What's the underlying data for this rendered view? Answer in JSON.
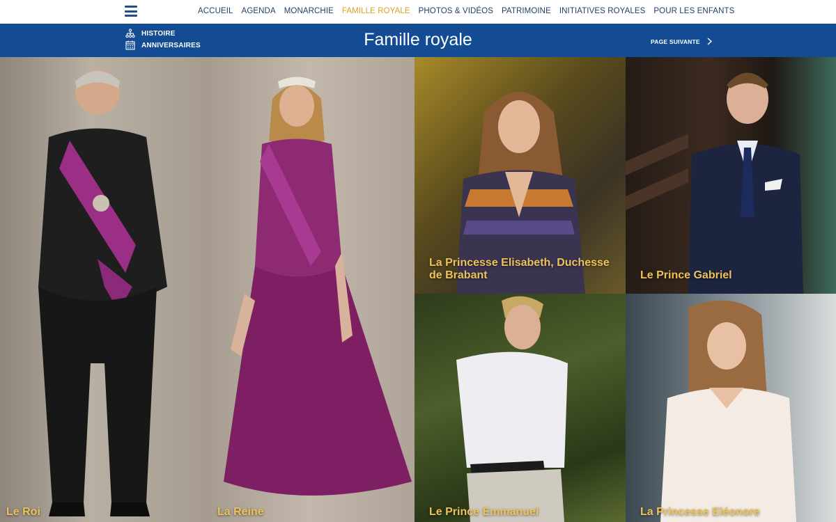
{
  "nav": {
    "menu_icon": "hamburger-menu-icon",
    "items": [
      {
        "label": "ACCUEIL",
        "active": false
      },
      {
        "label": "AGENDA",
        "active": false
      },
      {
        "label": "MONARCHIE",
        "active": false
      },
      {
        "label": "FAMILLE ROYALE",
        "active": true
      },
      {
        "label": "PHOTOS & VIDÉOS",
        "active": false
      },
      {
        "label": "PATRIMOINE",
        "active": false
      },
      {
        "label": "INITIATIVES ROYALES",
        "active": false
      },
      {
        "label": "POUR LES ENFANTS",
        "active": false
      }
    ]
  },
  "header": {
    "title": "Famille royale",
    "links": [
      {
        "label": "HISTOIRE",
        "icon": "family-tree-icon"
      },
      {
        "label": "ANNIVERSAIRES",
        "icon": "calendar-icon"
      }
    ],
    "next_page": {
      "label": "PAGE SUIVANTE",
      "icon": "chevron-right-icon"
    }
  },
  "members": [
    {
      "name": "Le Roi"
    },
    {
      "name": "La Reine"
    },
    {
      "name": "La Princesse Elisabeth, Duchesse de Brabant"
    },
    {
      "name": "Le Prince Gabriel"
    },
    {
      "name": "Le Prince Emmanuel"
    },
    {
      "name": "La Princesse Eléonore"
    }
  ],
  "colors": {
    "brand_blue": "#134c92",
    "nav_text": "#1f3f66",
    "active_nav": "#e0a020",
    "caption_gold": "#ecc25a"
  }
}
